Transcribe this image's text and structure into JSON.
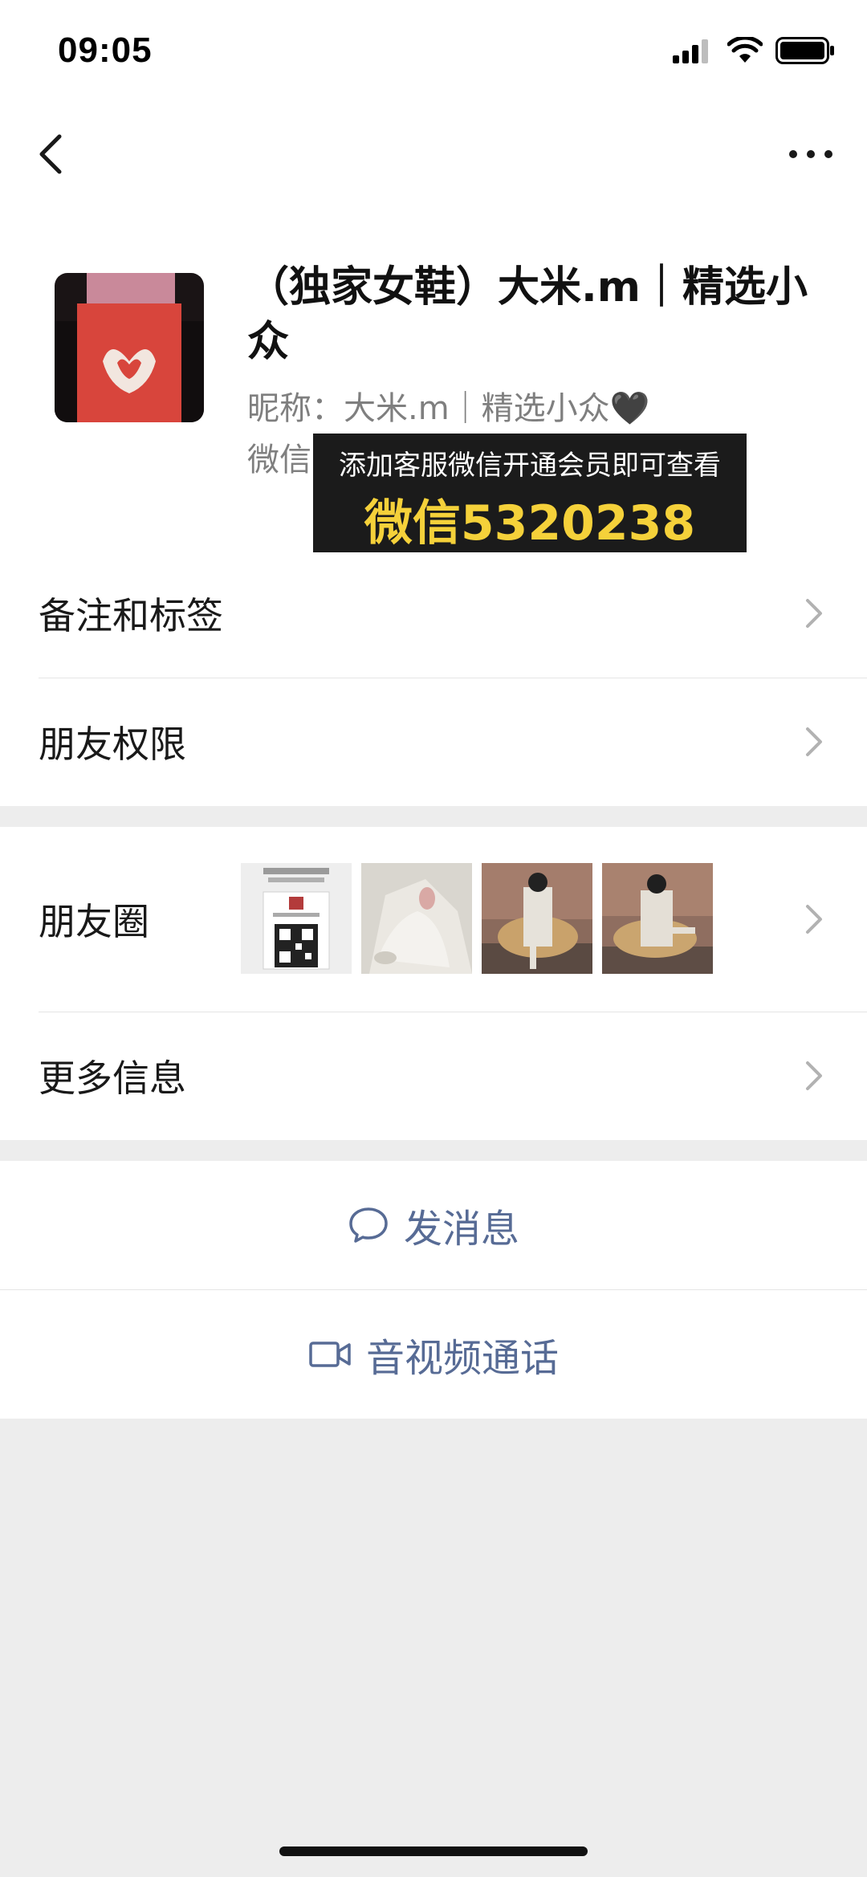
{
  "status_bar": {
    "time": "09:05"
  },
  "profile": {
    "title": "（独家女鞋）大米.m｜精选小众",
    "nickname": "昵称：大米.m｜精选小众🖤",
    "wechat_label": "微信"
  },
  "promo": {
    "line1": "添加客服微信开通会员即可查看",
    "line2": "微信5320238"
  },
  "menu": {
    "notes_tags": "备注和标签",
    "friend_permissions": "朋友权限",
    "moments": "朋友圈",
    "more_info": "更多信息"
  },
  "actions": {
    "send_message": "发消息",
    "video_call": "音视频通话"
  },
  "colors": {
    "link_blue": "#576b95",
    "promo_yellow": "#f5d13a",
    "bg_gray": "#ededed"
  }
}
